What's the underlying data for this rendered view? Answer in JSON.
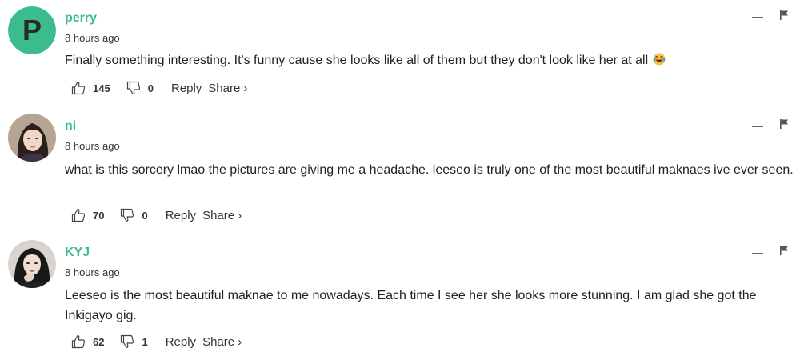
{
  "comments": [
    {
      "username": "perry",
      "avatar_letter": "P",
      "avatar_color": "#3cbc8d",
      "timestamp": "8 hours ago",
      "text": "Finally something interesting. It's funny cause she looks like all of them but they don't look like her at all",
      "emoji": "laughing-tears-emoji",
      "likes": "145",
      "dislikes": "0",
      "reply_label": "Reply",
      "share_label": "Share ›"
    },
    {
      "username": "ni",
      "avatar": "photo-avatar",
      "timestamp": "8 hours ago",
      "text": "what is this sorcery lmao the pictures are giving me a headache. leeseo is truly one of the most beautiful maknaes ive ever seen.",
      "likes": "70",
      "dislikes": "0",
      "reply_label": "Reply",
      "share_label": "Share ›"
    },
    {
      "username": "KYJ",
      "avatar": "photo-avatar",
      "timestamp": "8 hours ago",
      "text": "Leeseo is the most beautiful maknae to me nowadays. Each time I see her she looks more stunning. I am glad she got the Inkigayo gig.",
      "likes": "62",
      "dislikes": "1",
      "reply_label": "Reply",
      "share_label": "Share ›"
    }
  ],
  "colors": {
    "accent": "#3cbc8d",
    "text": "#222222",
    "muted": "#666666"
  }
}
